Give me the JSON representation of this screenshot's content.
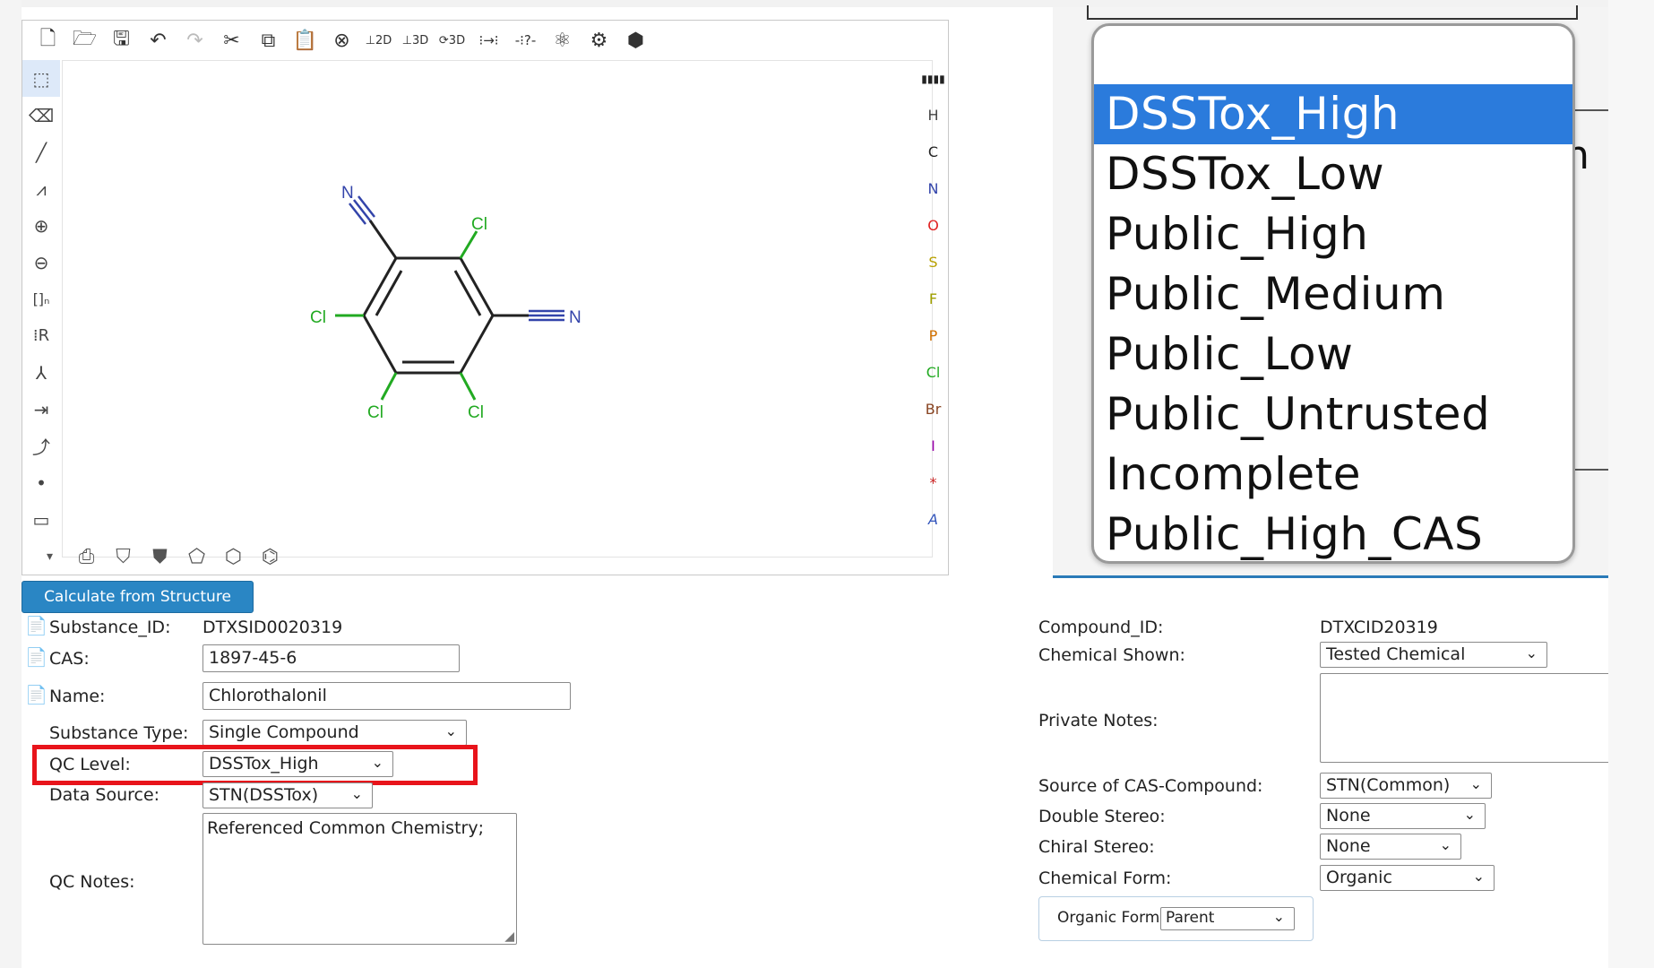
{
  "colors": {
    "accent": "#2a86c4",
    "highlight": "#e8141b",
    "selected_option": "#2b7bdc",
    "chlorine": "#22aa22",
    "nitrogen": "#3344aa"
  },
  "editor": {
    "top_icons": [
      "new-file-icon",
      "open-file-icon",
      "save-icon",
      "undo-icon",
      "redo-icon",
      "cut-icon",
      "copy-icon",
      "paste-icon",
      "zoom-icon",
      "layout-2d-icon",
      "clean-2d-icon",
      "layout-3d-icon",
      "aromatize-icon",
      "check-icon",
      "analyse-icon",
      "recognize-icon",
      "settings-icon",
      "info-icon"
    ],
    "left_icons": [
      "select-icon",
      "eraser-icon",
      "bond-icon",
      "chain-icon",
      "charge-plus-icon",
      "charge-minus-icon",
      "sgroup-icon",
      "rgroup-icon",
      "reaction-icon",
      "reaction-plus-icon",
      "mapping-icon",
      "atom-dot-icon",
      "shape-rect-icon"
    ],
    "atoms": [
      {
        "label": "H",
        "color": "#444444"
      },
      {
        "label": "C",
        "color": "#222222"
      },
      {
        "label": "N",
        "color": "#3344aa"
      },
      {
        "label": "O",
        "color": "#e02020"
      },
      {
        "label": "S",
        "color": "#b8a000"
      },
      {
        "label": "F",
        "color": "#a0a000"
      },
      {
        "label": "P",
        "color": "#d07000"
      },
      {
        "label": "Cl",
        "color": "#22aa22"
      },
      {
        "label": "Br",
        "color": "#884422"
      },
      {
        "label": "I",
        "color": "#9900aa"
      },
      {
        "label": "*",
        "color": "#cc2222"
      },
      {
        "label": "A",
        "color": "#3355bb"
      }
    ],
    "periodic_label": "periodic-table-icon",
    "molecule_labels": {
      "n1": "N",
      "n2": "N",
      "cl_top": "Cl",
      "cl_left": "Cl",
      "cl_bl": "Cl",
      "cl_br": "Cl"
    }
  },
  "calculate_button": "Calculate from Structure",
  "substance": {
    "substance_id_label": "Substance_ID:",
    "substance_id_value": "DTXSID0020319",
    "cas_label": "CAS:",
    "cas_value": "1897-45-6",
    "name_label": "Name:",
    "name_value": "Chlorothalonil",
    "type_label": "Substance Type:",
    "type_value": "Single Compound",
    "qc_label": "QC Level:",
    "qc_value": "DSSTox_High",
    "source_label": "Data Source:",
    "source_value": "STN(DSSTox)",
    "notes_label": "QC Notes:",
    "notes_value": "Referenced Common Chemistry;"
  },
  "compound": {
    "id_label": "Compound_ID:",
    "id_value": "DTXCID20319",
    "shown_label": "Chemical Shown:",
    "shown_value": "Tested Chemical",
    "private_label": "Private Notes:",
    "private_value": "",
    "cas_source_label": "Source of CAS-Compound:",
    "cas_source_value": "STN(Common)",
    "double_label": "Double Stereo:",
    "double_value": "None",
    "chiral_label": "Chiral Stereo:",
    "chiral_value": "None",
    "form_label": "Chemical Form:",
    "form_value": "Organic",
    "organic_label": "Organic Form:",
    "organic_value": "Parent"
  },
  "dropdown": {
    "options": [
      "DSSTox_High",
      "DSSTox_Low",
      "Public_High",
      "Public_Medium",
      "Public_Low",
      "Public_Untrusted",
      "Incomplete",
      "Public_High_CAS"
    ],
    "selected": "DSSTox_High",
    "side_glyph": "n"
  }
}
